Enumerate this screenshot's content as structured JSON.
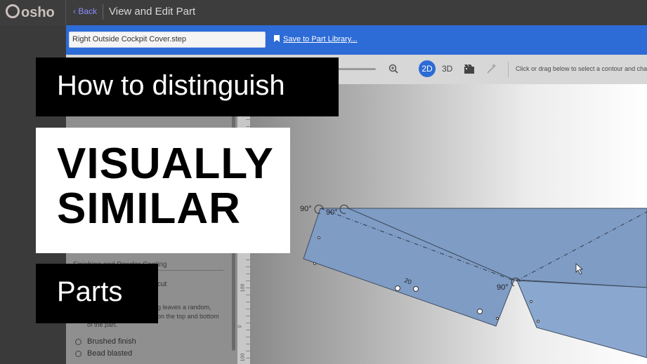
{
  "app": {
    "logo_text": "osho",
    "back_label": "Back",
    "page_title": "View and Edit Part"
  },
  "file": {
    "name": "Right Outside Cockpit Cover.step",
    "save_label": "Save to Part Library..."
  },
  "toolbar": {
    "btn_2d": "2D",
    "btn_3d": "3D",
    "hint": "Click or drag below to select a contour and cha"
  },
  "panel": {
    "section_heading": "Finishing and Powder Coating",
    "cut_label": "cut",
    "desc_line1": "g leaves a random,",
    "desc_line2": "on the top and bottom",
    "desc_line3": "of the part.",
    "options": [
      "Brushed finish",
      "Bead blasted"
    ]
  },
  "ruler": {
    "labels": [
      "100",
      "0",
      "100"
    ]
  },
  "drawing": {
    "angle_labels": [
      "90°",
      "90°",
      "90°"
    ],
    "part_label": "20",
    "part_fill": "#7f9cc4"
  },
  "overlay": {
    "line1": "How to distinguish",
    "line2a": "VISUALLY",
    "line2b": "SIMILAR",
    "line3": "Parts"
  }
}
